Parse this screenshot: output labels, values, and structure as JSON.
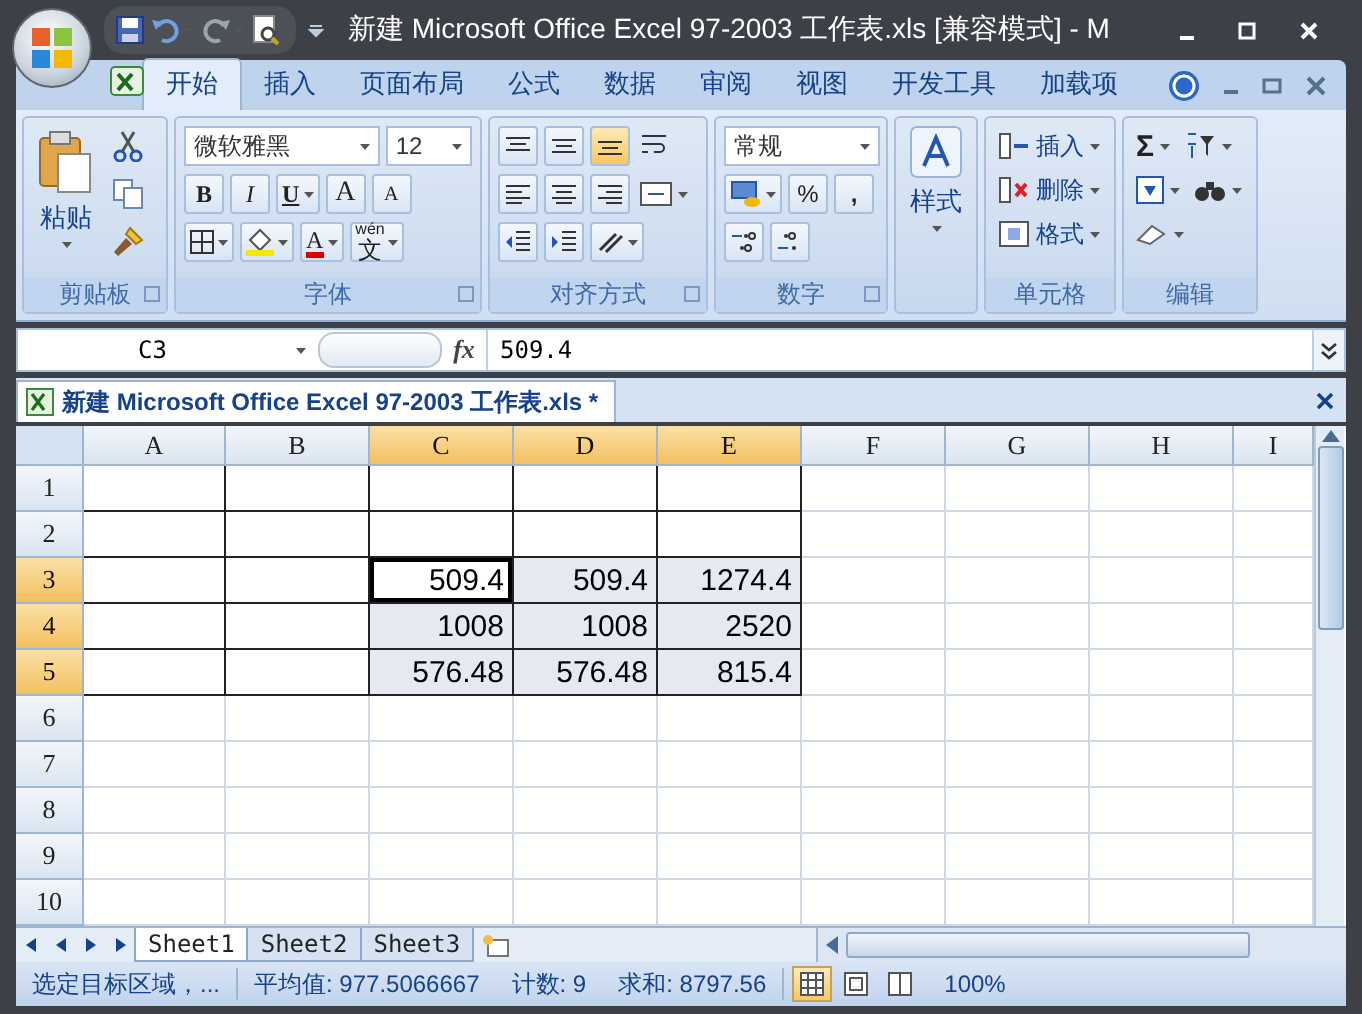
{
  "window": {
    "title": "新建 Microsoft Office Excel 97-2003 工作表.xls  [兼容模式] - M"
  },
  "ribbon_tabs": [
    {
      "label": "开始",
      "selected": true
    },
    {
      "label": "插入",
      "selected": false
    },
    {
      "label": "页面布局",
      "selected": false
    },
    {
      "label": "公式",
      "selected": false
    },
    {
      "label": "数据",
      "selected": false
    },
    {
      "label": "审阅",
      "selected": false
    },
    {
      "label": "视图",
      "selected": false
    },
    {
      "label": "开发工具",
      "selected": false
    },
    {
      "label": "加载项",
      "selected": false
    }
  ],
  "clipboard": {
    "paste": "粘贴",
    "group": "剪贴板"
  },
  "font": {
    "name": "微软雅黑",
    "size": "12",
    "bold": "B",
    "italic": "I",
    "underline": "U",
    "grow": "A",
    "shrink": "A",
    "font_color_label": "A",
    "phonetic_top": "wén",
    "phonetic": "文",
    "group": "字体"
  },
  "alignment": {
    "group": "对齐方式"
  },
  "number": {
    "format": "常规",
    "percent": "%",
    "comma": ",",
    "group": "数字"
  },
  "styles": {
    "label": "样式"
  },
  "cells_group": {
    "insert": "插入",
    "delete": "删除",
    "format": "格式",
    "group": "单元格"
  },
  "editing": {
    "sum": "Σ",
    "group": "编辑"
  },
  "formula_bar": {
    "name_box": "C3",
    "function_label": "fx",
    "value": "509.4"
  },
  "document_tab": {
    "title": "新建 Microsoft Office Excel 97-2003 工作表.xls *"
  },
  "sheet": {
    "columns": [
      {
        "label": "A",
        "selected": false
      },
      {
        "label": "B",
        "selected": false
      },
      {
        "label": "C",
        "selected": true
      },
      {
        "label": "D",
        "selected": true
      },
      {
        "label": "E",
        "selected": true
      },
      {
        "label": "F",
        "selected": false
      },
      {
        "label": "G",
        "selected": false
      },
      {
        "label": "H",
        "selected": false
      },
      {
        "label": "I",
        "selected": false
      }
    ],
    "rows": [
      {
        "label": "1",
        "selected": false,
        "cells": [
          {
            "bordered": true,
            "selected": false,
            "active": false
          },
          {
            "bordered": true,
            "selected": false,
            "active": false
          },
          {
            "bordered": true,
            "selected": false,
            "active": false
          },
          {
            "bordered": true,
            "selected": false,
            "active": false
          },
          {
            "bordered": true,
            "selected": false,
            "active": false
          }
        ]
      },
      {
        "label": "2",
        "selected": false,
        "cells": [
          {
            "bordered": true,
            "selected": false,
            "active": false
          },
          {
            "bordered": true,
            "selected": false,
            "active": false
          },
          {
            "bordered": true,
            "selected": false,
            "active": false
          },
          {
            "bordered": true,
            "selected": false,
            "active": false
          },
          {
            "bordered": true,
            "selected": false,
            "active": false
          }
        ]
      },
      {
        "label": "3",
        "selected": true,
        "cells": [
          {
            "bordered": true,
            "selected": false,
            "active": false
          },
          {
            "bordered": true,
            "selected": false,
            "active": false
          },
          {
            "value": "509.4",
            "bordered": true,
            "selected": true,
            "active": true
          },
          {
            "value": "509.4",
            "bordered": true,
            "selected": true,
            "active": false
          },
          {
            "value": "1274.4",
            "bordered": true,
            "selected": true,
            "active": false
          }
        ]
      },
      {
        "label": "4",
        "selected": true,
        "cells": [
          {
            "bordered": true,
            "selected": false,
            "active": false
          },
          {
            "bordered": true,
            "selected": false,
            "active": false
          },
          {
            "value": "1008",
            "bordered": true,
            "selected": true,
            "active": false
          },
          {
            "value": "1008",
            "bordered": true,
            "selected": true,
            "active": false
          },
          {
            "value": "2520",
            "bordered": true,
            "selected": true,
            "active": false
          }
        ]
      },
      {
        "label": "5",
        "selected": true,
        "cells": [
          {
            "bordered": true,
            "selected": false,
            "active": false
          },
          {
            "bordered": true,
            "selected": false,
            "active": false
          },
          {
            "value": "576.48",
            "bordered": true,
            "selected": true,
            "active": false
          },
          {
            "value": "576.48",
            "bordered": true,
            "selected": true,
            "active": false
          },
          {
            "value": "815.4",
            "bordered": true,
            "selected": true,
            "active": false
          }
        ]
      },
      {
        "label": "6",
        "selected": false
      },
      {
        "label": "7",
        "selected": false
      },
      {
        "label": "8",
        "selected": false
      },
      {
        "label": "9",
        "selected": false
      },
      {
        "label": "10",
        "selected": false
      }
    ]
  },
  "sheet_tabs": [
    {
      "label": "Sheet1",
      "selected": true
    },
    {
      "label": "Sheet2",
      "selected": false
    },
    {
      "label": "Sheet3",
      "selected": false
    }
  ],
  "status_bar": {
    "message": "选定目标区域，...",
    "average": "平均值: 977.5066667",
    "count": "计数: 9",
    "sum": "求和: 8797.56",
    "views": [
      {
        "selected": true
      },
      {
        "selected": false
      },
      {
        "selected": false
      }
    ],
    "zoom": "100%"
  }
}
